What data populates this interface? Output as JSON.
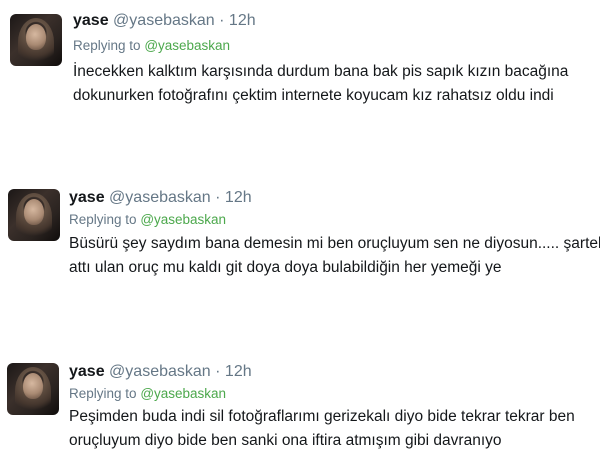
{
  "tweets": [
    {
      "name": "yase",
      "handle": "@yasebaskan",
      "dot": "·",
      "time": "12h",
      "replying_prefix": "Replying to",
      "replying_to": "@yasebaskan",
      "line1": "İnecekken kalktım karşısında durdum bana bak pis sapık kızın bacağına",
      "line2": "dokunurken fotoğrafını çektim internete koyucam kız rahatsız oldu indi"
    },
    {
      "name": "yase",
      "handle": "@yasebaskan",
      "dot": "·",
      "time": "12h",
      "replying_prefix": "Replying to",
      "replying_to": "@yasebaskan",
      "line1": "Büsürü şey saydım bana demesin mi ben oruçluyum sen ne diyosun..... şartel",
      "line2": "attı ulan oruç mu kaldı git doya doya bulabildiğin her yemeği ye"
    },
    {
      "name": "yase",
      "handle": "@yasebaskan",
      "dot": "·",
      "time": "12h",
      "replying_prefix": "Replying to",
      "replying_to": "@yasebaskan",
      "line1": "Peşimden buda indi sil fotoğraflarımı gerizekalı diyo bide tekrar tekrar ben",
      "line2": "oruçluyum diyo bide ben sanki ona iftira atmışım gibi davranıyo"
    }
  ]
}
